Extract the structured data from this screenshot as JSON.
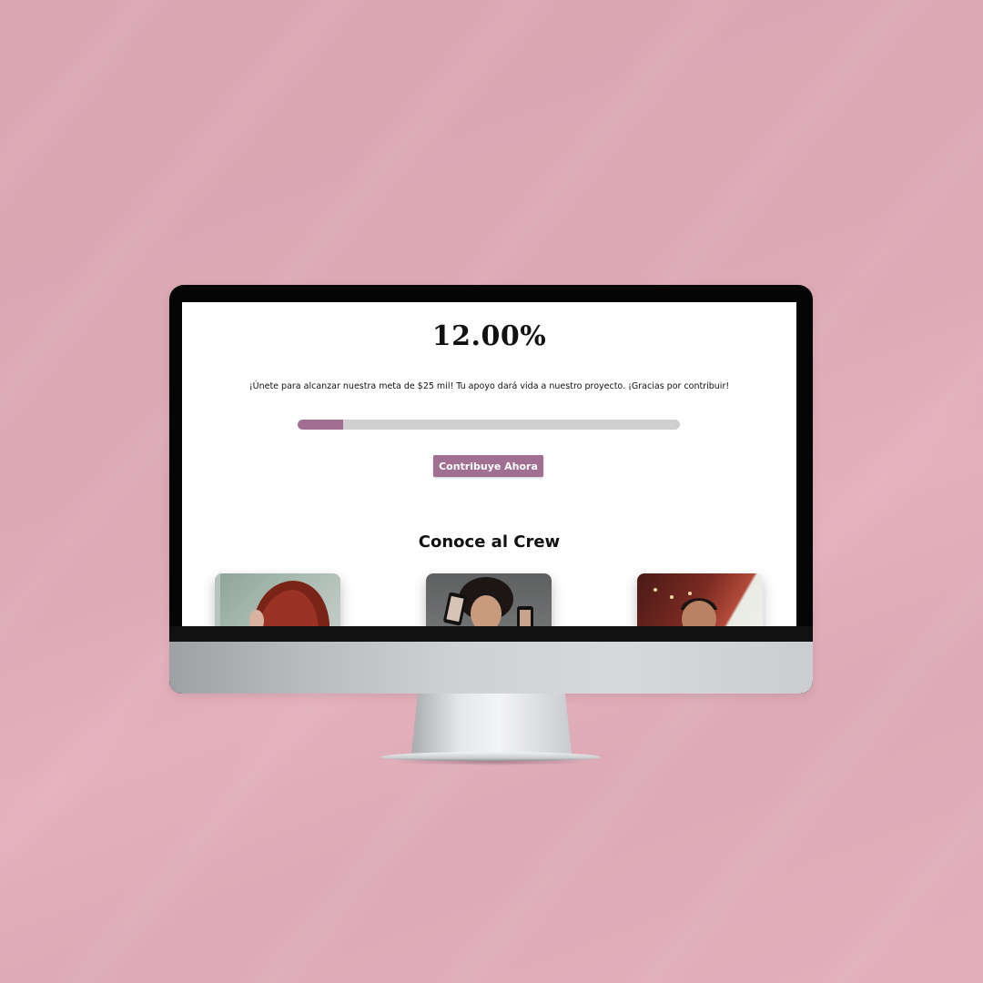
{
  "campaign": {
    "percent_label": "12.00%",
    "description": "¡Únete para alcanzar nuestra meta de $25 mil! Tu apoyo dará vida a nuestro proyecto. ¡Gracias por contribuir!",
    "progress_fraction": 0.12,
    "cta_label": "Contribuye Ahora"
  },
  "crew": {
    "title": "Conoce al Crew",
    "members": [
      {
        "photo": "woman-red-hair-photo"
      },
      {
        "photo": "man-curly-hair-phones-photo"
      },
      {
        "photo": "man-smiling-photo"
      }
    ]
  },
  "colors": {
    "accent": "#a06f92",
    "background": "#dba8b4",
    "track": "#cfcfcf"
  }
}
